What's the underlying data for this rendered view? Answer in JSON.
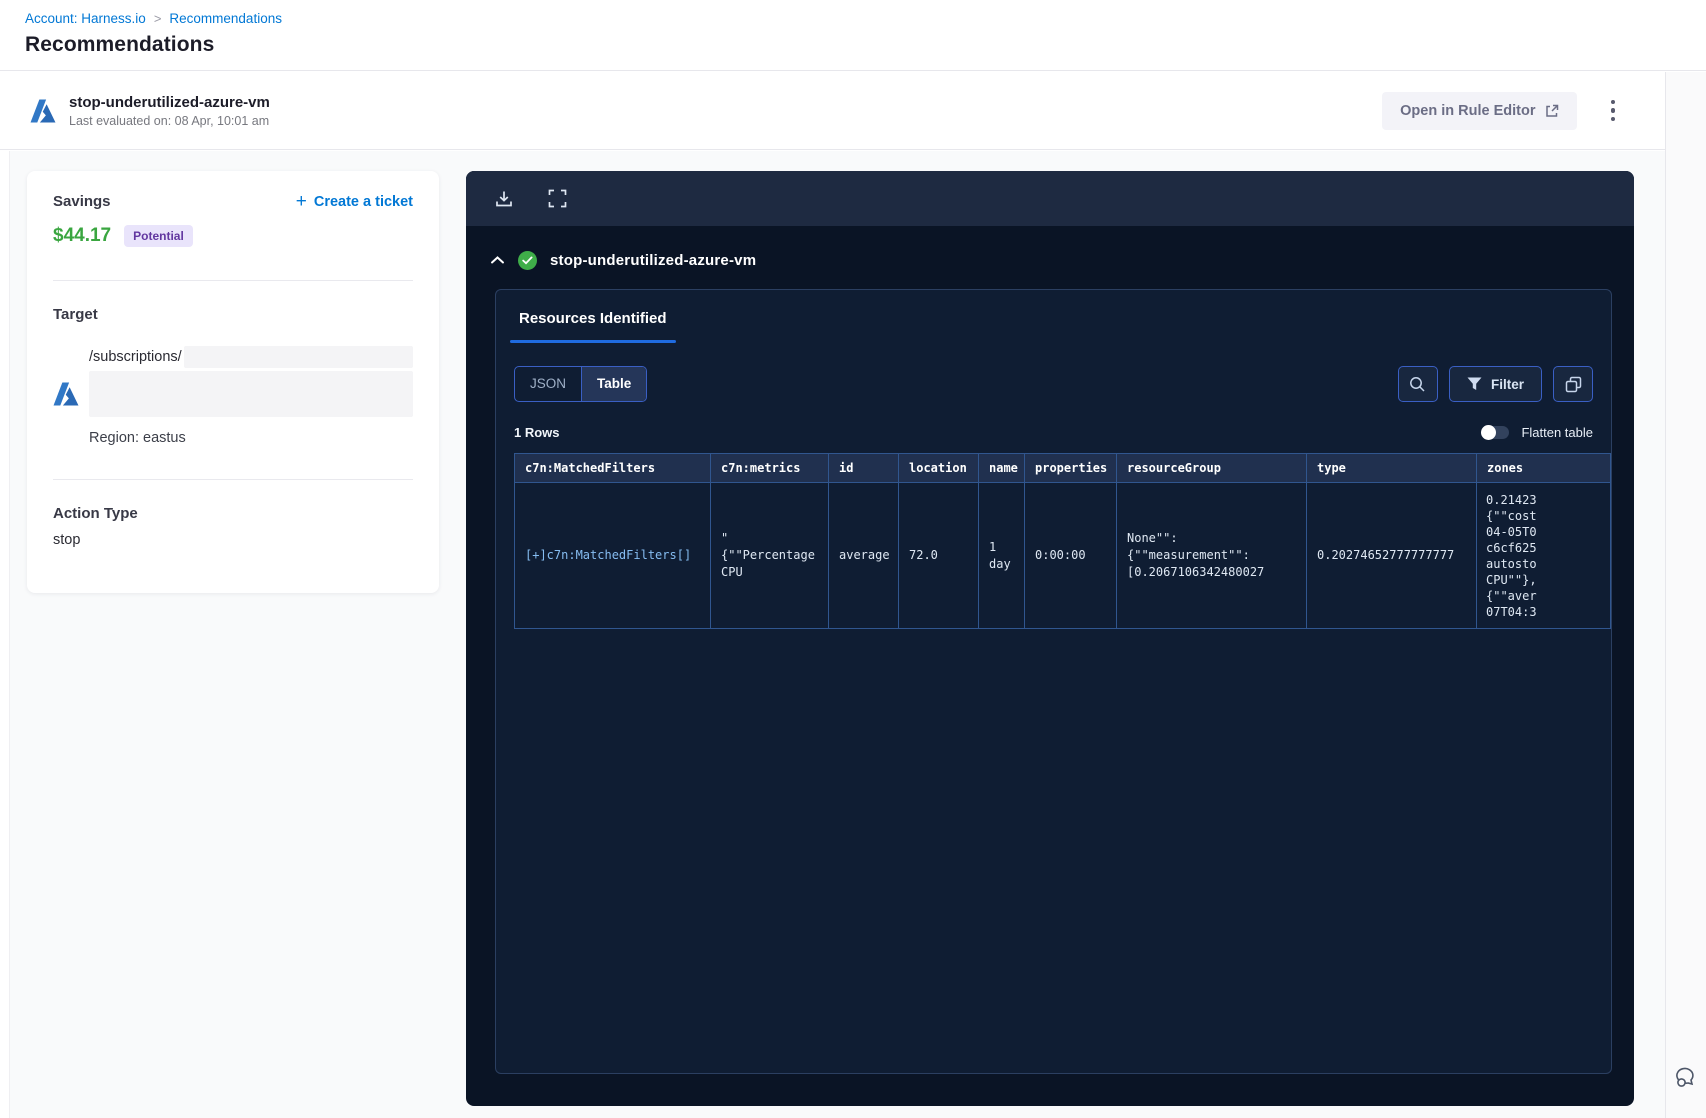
{
  "breadcrumb": {
    "account": "Account: Harness.io",
    "separator": ">",
    "page": "Recommendations"
  },
  "page_title": "Recommendations",
  "rule_header": {
    "name": "stop-underutilized-azure-vm",
    "last_evaluated": "Last evaluated on: 08 Apr, 10:01 am",
    "open_in_rule_editor": "Open in Rule Editor"
  },
  "savings_card": {
    "savings_label": "Savings",
    "amount": "$44.17",
    "badge": "Potential",
    "create_ticket": "Create a ticket",
    "target_label": "Target",
    "target_path": "/subscriptions/",
    "region": "Region: eastus",
    "action_type_label": "Action Type",
    "action_type_value": "stop"
  },
  "panel": {
    "rule_name": "stop-underutilized-azure-vm",
    "tab": "Resources Identified",
    "json_toggle": "JSON",
    "table_toggle": "Table",
    "filter_label": "Filter",
    "rows_count": "1 Rows",
    "flatten_label": "Flatten table"
  },
  "table": {
    "columns": [
      "c7n:MatchedFilters",
      "c7n:metrics",
      "id",
      "location",
      "name",
      "properties",
      "resourceGroup",
      "type",
      "zones"
    ],
    "row": {
      "matched_filters": "[+]c7n:MatchedFilters[]",
      "metrics": "\"\n{\"\"Percentage\nCPU",
      "id": "average",
      "location": "72.0",
      "name": "1\nday",
      "properties": "0:00:00",
      "resource_group": "None\"\":\n{\"\"measurement\"\":\n[0.2067106342480027",
      "type": "0.20274652777777777",
      "zones": "0.21423\n{\"\"cost\n04-05T0\nc6cf625\nautosto\nCPU\"\"},\n{\"\"aver\n07T04:3"
    }
  },
  "colors": {
    "link_blue": "#0278d5",
    "savings_green": "#3aa640",
    "badge_purple": "#6237a0",
    "success_green": "#3fae49",
    "panel_button_border": "#3a5fc4",
    "tab_underline": "#1f6be0"
  }
}
